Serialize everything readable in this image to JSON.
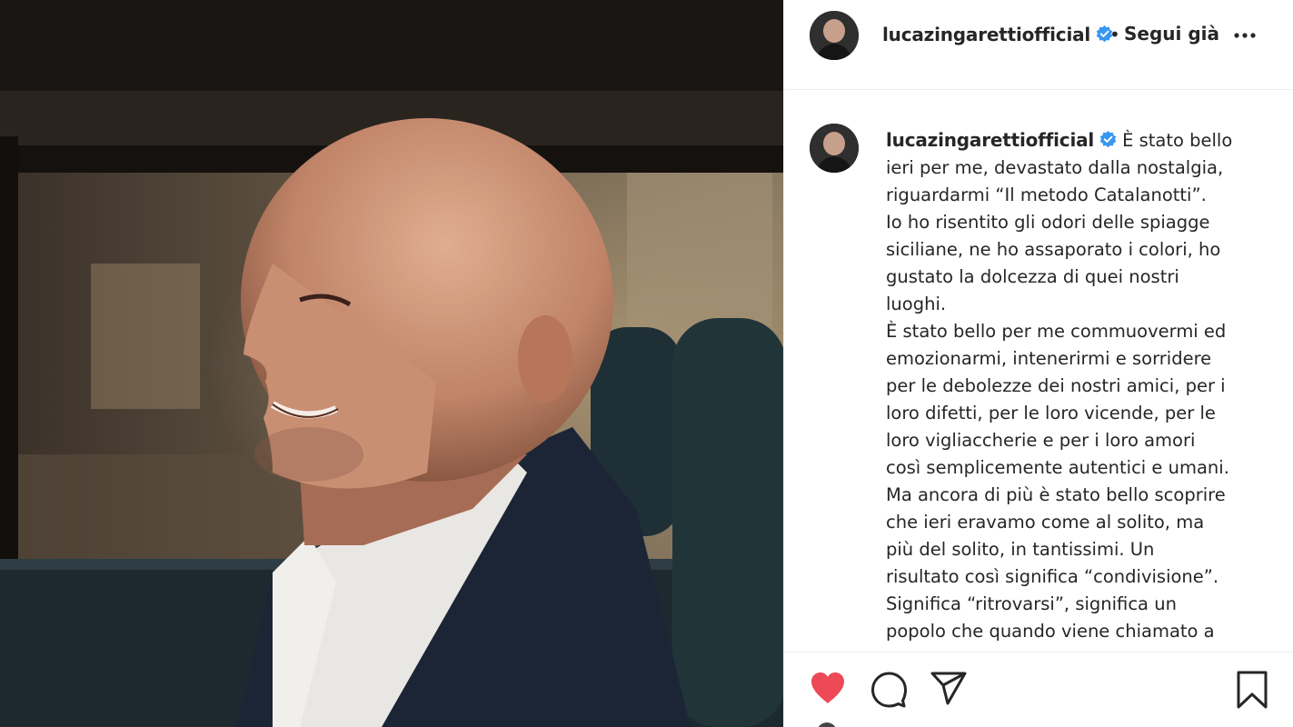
{
  "post": {
    "username": "lucazingarettiofficial",
    "verified_icon": "verified-badge-icon",
    "separator": "•",
    "follow_status": "Segui già",
    "more_icon": "more-options-icon"
  },
  "caption": {
    "username": "lucazingarettiofficial",
    "text": "È stato bello\nieri per me, devastato dalla nostalgia,\nriguardarmi “Il metodo Catalanotti”.\nIo ho risentito gli odori delle spiagge\nsiciliane, ne ho assaporato i colori, ho\ngustato la dolcezza di quei nostri\nluoghi.\nÈ stato bello per me commuovermi ed\nemozionarmi, intenerirmi e sorridere\nper le debolezze dei nostri amici, per i\nloro difetti, per le loro vicende, per le\nloro vigliaccherie e per i loro amori\ncosì semplicemente autentici e umani.\nMa ancora di più è stato bello scoprire\nche ieri eravamo come al solito, ma\npiù del solito, in tantissimi. Un\nrisultato così significa “condivisione”.\nSignifica “ritrovarsi”, significa un\npopolo che quando viene chiamato a"
  },
  "actions": {
    "like_icon": "heart-filled-icon",
    "comment_icon": "comment-icon",
    "share_icon": "share-icon",
    "save_icon": "bookmark-icon",
    "like_color": "#ed4956"
  },
  "colors": {
    "text": "#262626",
    "verified": "#3897f0",
    "divider": "#efefef"
  }
}
